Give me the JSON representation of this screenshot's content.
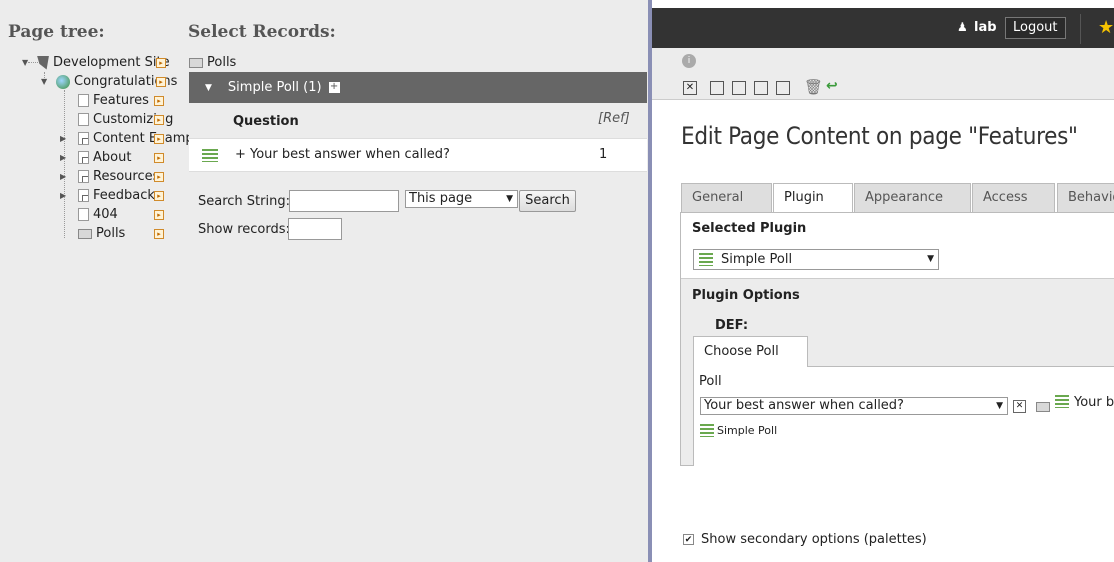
{
  "left": {
    "page_tree_title": "Page tree:",
    "select_records_title": "Select Records:",
    "tree": [
      {
        "label": "Development Site",
        "icon": "typo3-root-icon"
      },
      {
        "label": "Congratulations",
        "icon": "globe-icon"
      },
      {
        "label": "Features",
        "icon": "page-icon"
      },
      {
        "label": "Customizing",
        "icon": "page-icon"
      },
      {
        "label": "Content Examples",
        "icon": "page-shortcut-icon"
      },
      {
        "label": "About",
        "icon": "page-shortcut-icon"
      },
      {
        "label": "Resources",
        "icon": "page-shortcut-icon"
      },
      {
        "label": "Feedback",
        "icon": "page-shortcut-icon"
      },
      {
        "label": "404",
        "icon": "page-icon"
      },
      {
        "label": "Polls",
        "icon": "folder-icon"
      }
    ],
    "records": {
      "folder_label": "Polls",
      "group_label": "Simple Poll (1)",
      "col_question": "Question",
      "col_ref": "[Ref]",
      "rows": [
        {
          "question": "Your best answer when called?",
          "ref": "1"
        }
      ]
    },
    "search": {
      "string_label": "Search String:",
      "string_value": "",
      "scope_value": "This page",
      "button": "Search",
      "show_label": "Show records:",
      "show_value": ""
    }
  },
  "right": {
    "user": "lab",
    "logout": "Logout",
    "heading": "Edit Page Content on page \"Features\"",
    "tabs": [
      "General",
      "Plugin",
      "Appearance",
      "Access",
      "Behavio"
    ],
    "selected_plugin_label": "Selected Plugin",
    "selected_plugin_value": "Simple Poll",
    "plugin_options_label": "Plugin Options",
    "def_label": "DEF:",
    "subtab": "Choose Poll",
    "poll_label": "Poll",
    "poll_value": "Your best answer when called?",
    "poll_ref_text": "Your b",
    "poll_plugin_link": "Simple Poll",
    "secondary_options": "Show secondary options (palettes)",
    "secondary_checked": true
  }
}
